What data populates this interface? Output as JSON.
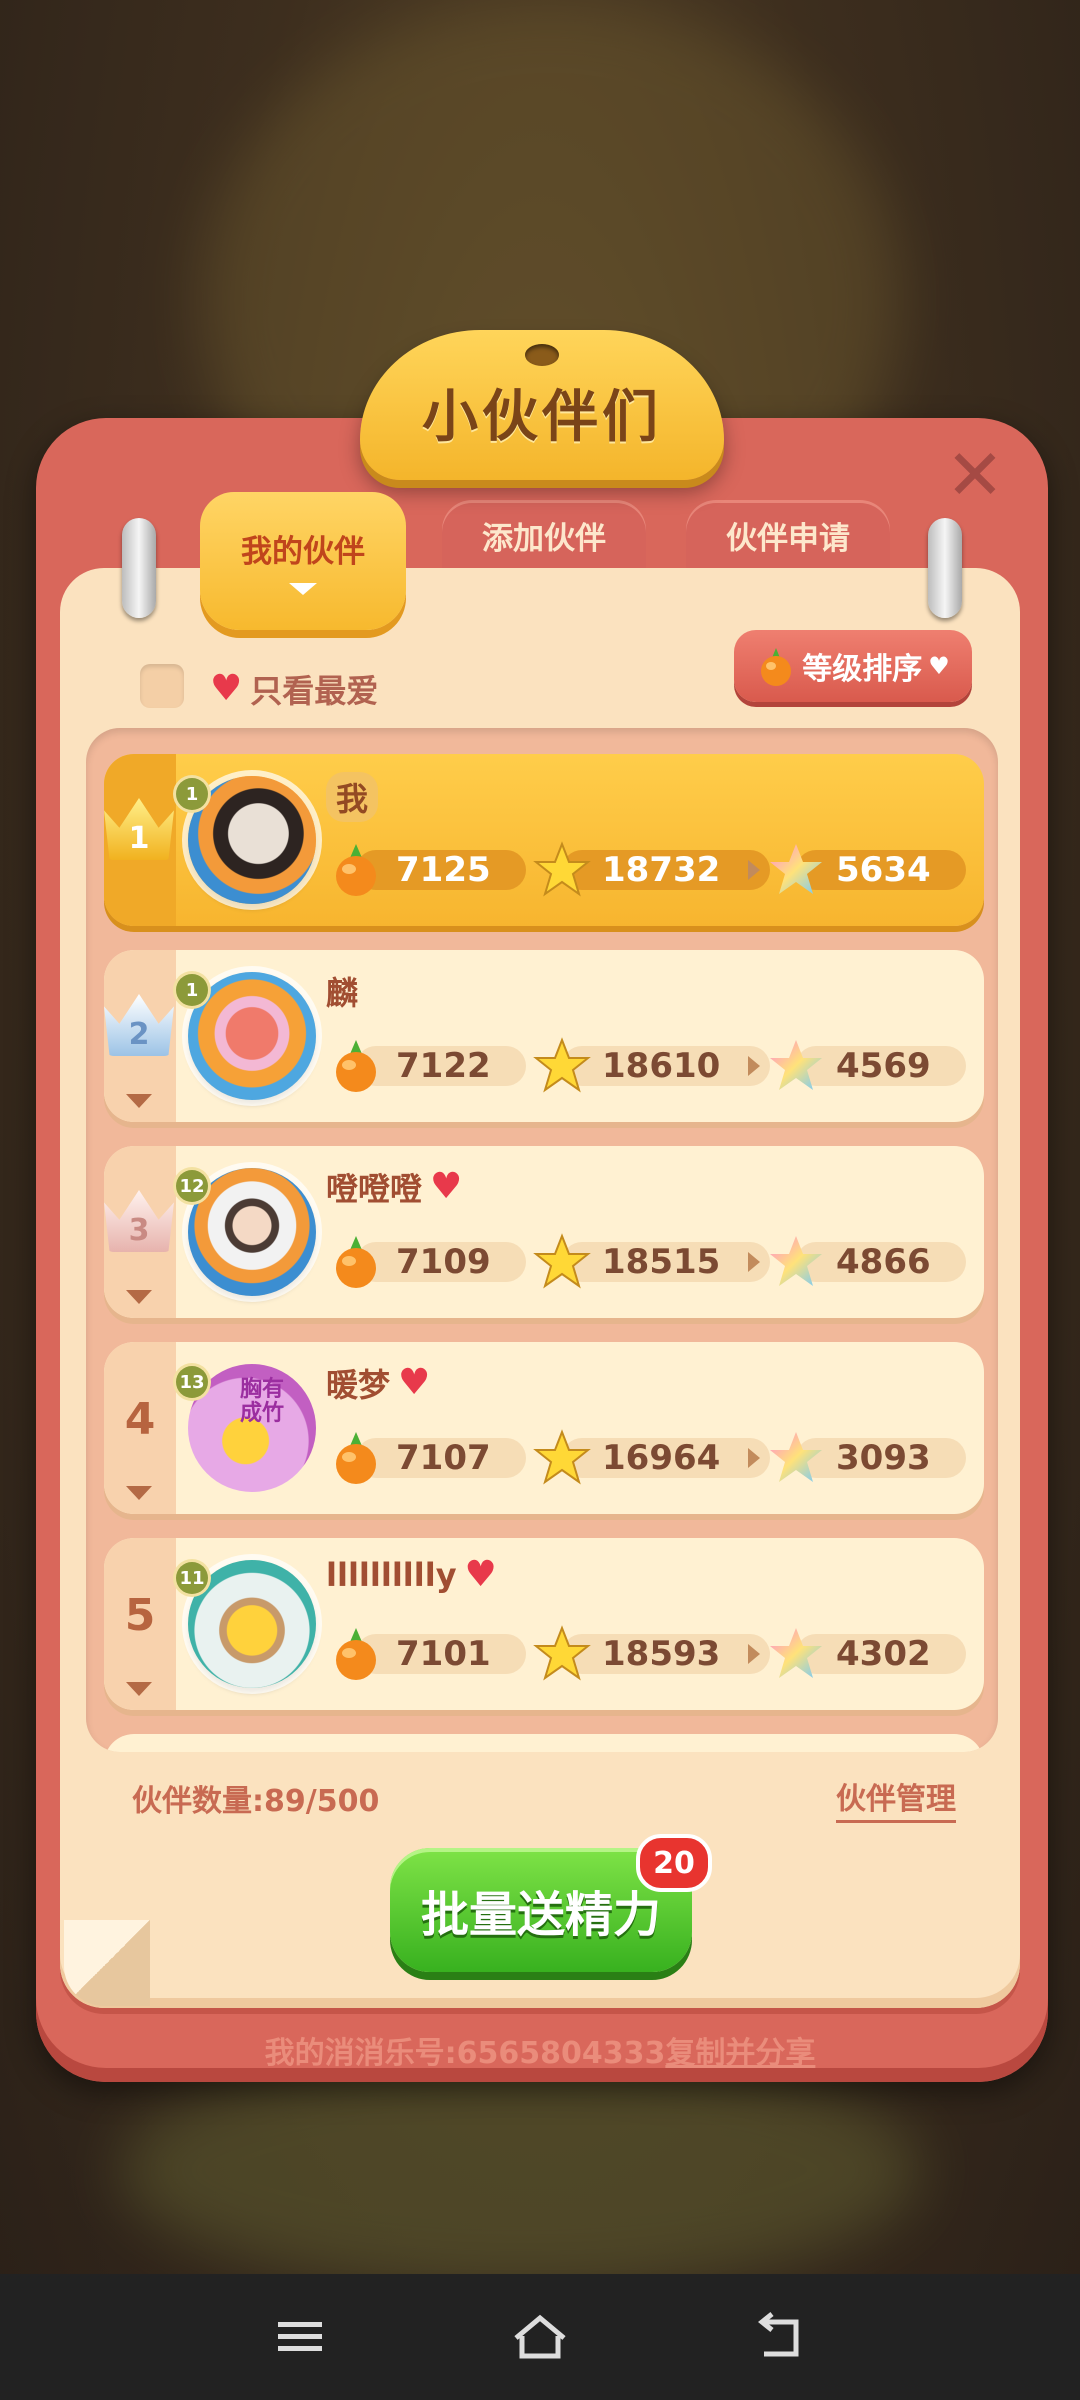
{
  "window": {
    "title": "小伙伴们"
  },
  "tabs": [
    {
      "label": "我的伙伴",
      "active": true
    },
    {
      "label": "添加伙伴",
      "active": false
    },
    {
      "label": "伙伴申请",
      "active": false
    }
  ],
  "filter": {
    "favorites_only_label": "只看最爱",
    "favorites_only_checked": false
  },
  "sort": {
    "label": "等级排序"
  },
  "friends": [
    {
      "rank": "1",
      "level": "1",
      "name": "我",
      "favorite": false,
      "stat1": "7125",
      "stat2": "18732",
      "stat3": "5634",
      "me": true
    },
    {
      "rank": "2",
      "level": "1",
      "name": "麟",
      "favorite": false,
      "stat1": "7122",
      "stat2": "18610",
      "stat3": "4569",
      "me": false
    },
    {
      "rank": "3",
      "level": "12",
      "name": "噔噔噔",
      "favorite": true,
      "stat1": "7109",
      "stat2": "18515",
      "stat3": "4866",
      "me": false
    },
    {
      "rank": "4",
      "level": "13",
      "name": "暖梦",
      "favorite": true,
      "stat1": "7107",
      "stat2": "16964",
      "stat3": "3093",
      "me": false
    },
    {
      "rank": "5",
      "level": "11",
      "name": "lllllllllly",
      "favorite": true,
      "stat1": "7101",
      "stat2": "18593",
      "stat3": "4302",
      "me": false
    }
  ],
  "avatar_sticker_text": "胸有成竹",
  "footer": {
    "count_label": "伙伴数量:89/500",
    "manage_label": "伙伴管理",
    "gift_button": "批量送精力",
    "gift_badge": "20",
    "account_label": "我的消消乐号:6565804333",
    "copy_share_label": "复制并分享"
  },
  "colors": {
    "panel": "#d9675b",
    "inner": "#fbe2bf",
    "accent": "#f7b52f",
    "button": "#38b11f",
    "heart": "#e8394b"
  }
}
